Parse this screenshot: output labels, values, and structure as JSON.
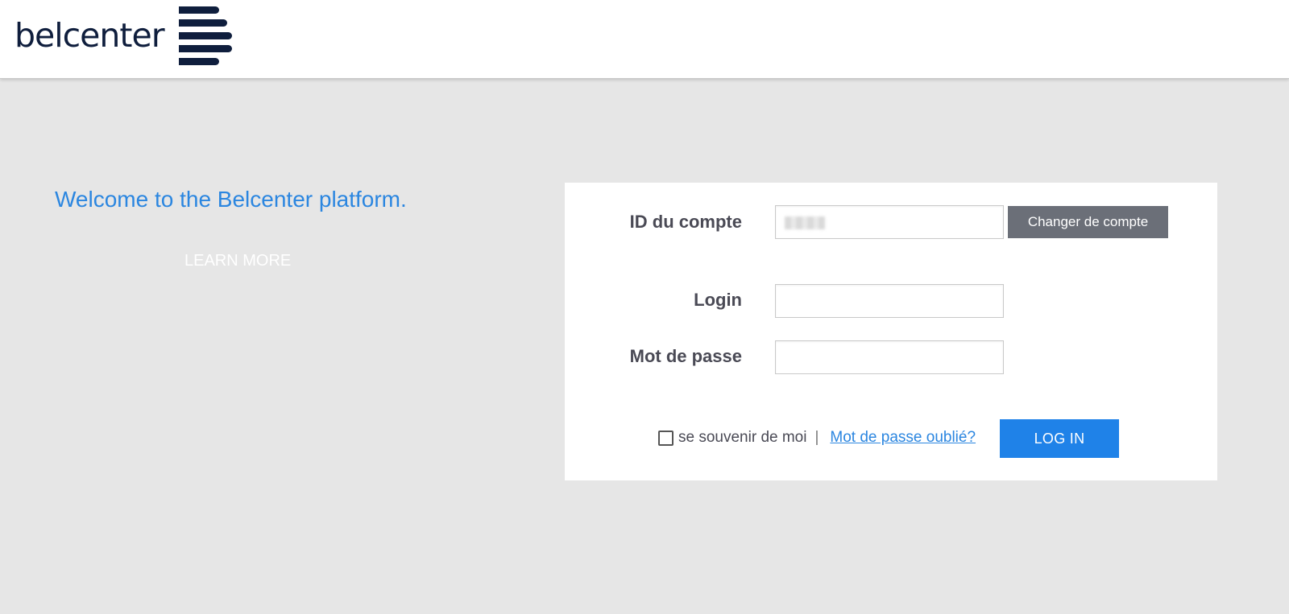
{
  "header": {
    "logo_text": "belcenter",
    "logo_icon": "stacked-bars-logo-icon"
  },
  "welcome": {
    "title": "Welcome to the Belcenter platform.",
    "learn_more_label": "LEARN MORE"
  },
  "login_form": {
    "account_id_label": "ID du compte",
    "account_id_value": "",
    "change_account_label": "Changer de compte",
    "login_label": "Login",
    "login_value": "",
    "password_label": "Mot de passe",
    "password_value": "",
    "remember_label": "se souvenir de moi",
    "remember_checked": false,
    "separator": "|",
    "forgot_password_label": "Mot de passe oublié?",
    "login_button_label": "LOG IN"
  },
  "colors": {
    "brand_navy": "#0f1e3d",
    "accent_blue": "#1f82e8",
    "welcome_blue": "#2b86e0",
    "secondary_button": "#6b6f78",
    "page_background": "#e6e6e6"
  }
}
